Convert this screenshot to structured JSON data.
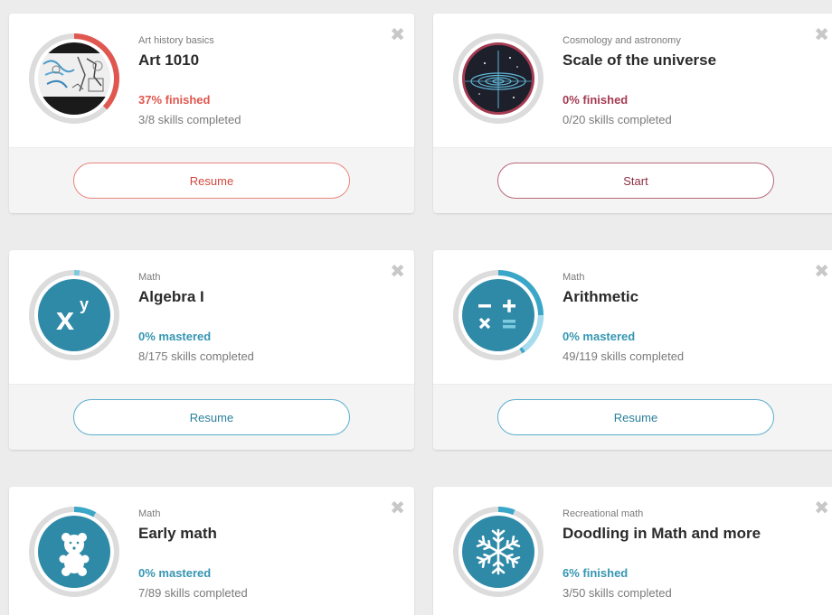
{
  "colors": {
    "red": "#e0574f",
    "maroon": "#a53b52",
    "teal": "#3596b2",
    "teal_light": "#7ecbe0",
    "ring_gray": "#dcdcdc"
  },
  "cards": [
    {
      "subject": "Art history basics",
      "title": "Art 1010",
      "progress": "37% finished",
      "progress_fraction": 0.37,
      "skills": "3/8 skills completed",
      "button": "Resume",
      "accent": "#e0574f",
      "icon": "art-sketch-thumbnail"
    },
    {
      "subject": "Cosmology and astronomy",
      "title": "Scale of the universe",
      "progress": "0% finished",
      "progress_fraction": 0,
      "skills": "0/20 skills completed",
      "button": "Start",
      "accent": "#a53b52",
      "icon": "galaxy-icon"
    },
    {
      "subject": "Math",
      "title": "Algebra I",
      "progress": "0% mastered",
      "progress_fraction": 0.02,
      "skills": "8/175 skills completed",
      "button": "Resume",
      "accent": "#3596b2",
      "icon": "exponent-icon"
    },
    {
      "subject": "Math",
      "title": "Arithmetic",
      "progress": "0% mastered",
      "progress_fraction": 0.41,
      "skills": "49/119 skills completed",
      "button": "Resume",
      "accent": "#3596b2",
      "icon": "arithmetic-operators-icon"
    },
    {
      "subject": "Math",
      "title": "Early math",
      "progress": "0% mastered",
      "progress_fraction": 0.08,
      "skills": "7/89 skills completed",
      "button": "Resume",
      "accent": "#3596b2",
      "icon": "teddy-bear-icon"
    },
    {
      "subject": "Recreational math",
      "title": "Doodling in Math and more",
      "progress": "6% finished",
      "progress_fraction": 0.06,
      "skills": "3/50 skills completed",
      "button": "Resume",
      "accent": "#3596b2",
      "icon": "snowflake-icon"
    }
  ],
  "close_glyph": "✖"
}
